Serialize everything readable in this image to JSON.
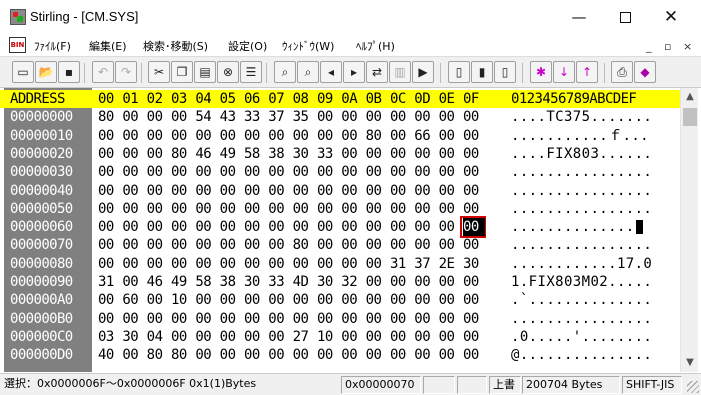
{
  "window": {
    "title": "Stirling - [CM.SYS]",
    "minimize_glyph": "—",
    "close_glyph": "✕"
  },
  "menu": {
    "logo_text": "BIN",
    "items": [
      {
        "label": "ﾌｧｲﾙ(F)"
      },
      {
        "label": "編集(E)"
      },
      {
        "label": "検索･移動(S)"
      },
      {
        "label": "設定(O)"
      },
      {
        "label": "ｳｨﾝﾄﾞｳ(W)"
      },
      {
        "label": "ﾍﾙﾌﾟ(H)"
      }
    ],
    "mdi_min": "_",
    "mdi_restore": "▫",
    "mdi_close": "×"
  },
  "toolbar": {
    "buttons": [
      {
        "name": "new-file",
        "glyph": "▭"
      },
      {
        "name": "open-file",
        "glyph": "📂"
      },
      {
        "name": "save-file",
        "glyph": "▪"
      },
      {
        "name": "undo",
        "glyph": "↶"
      },
      {
        "name": "redo",
        "glyph": "↷"
      },
      {
        "name": "cut",
        "glyph": "✂"
      },
      {
        "name": "copy",
        "glyph": "❐"
      },
      {
        "name": "paste",
        "glyph": "▤"
      },
      {
        "name": "delete",
        "glyph": "⊗"
      },
      {
        "name": "select-all",
        "glyph": "☰"
      },
      {
        "name": "find",
        "glyph": "⌕"
      },
      {
        "name": "find-data",
        "glyph": "⌕"
      },
      {
        "name": "find-prev",
        "glyph": "◂"
      },
      {
        "name": "find-next",
        "glyph": "▸"
      },
      {
        "name": "replace",
        "glyph": "⇄"
      },
      {
        "name": "compare",
        "glyph": "▥"
      },
      {
        "name": "goto",
        "glyph": "▶"
      },
      {
        "name": "insert-mode",
        "glyph": "▯"
      },
      {
        "name": "overwrite-mode",
        "glyph": "▮"
      },
      {
        "name": "append-mode",
        "glyph": "▯"
      },
      {
        "name": "mark",
        "glyph": "✱"
      },
      {
        "name": "mark-next",
        "glyph": "↓"
      },
      {
        "name": "mark-prev",
        "glyph": "↑"
      },
      {
        "name": "print",
        "glyph": "⎙"
      },
      {
        "name": "bookmark",
        "glyph": "◆"
      }
    ]
  },
  "hex": {
    "header": {
      "address_label": "ADDRESS",
      "columns": [
        "00",
        "01",
        "02",
        "03",
        "04",
        "05",
        "06",
        "07",
        "08",
        "09",
        "0A",
        "0B",
        "0C",
        "0D",
        "0E",
        "0F"
      ],
      "ascii_label": "0123456789ABCDEF"
    },
    "rows": [
      {
        "addr": "00000000",
        "bytes": [
          "80",
          "00",
          "00",
          "00",
          "54",
          "43",
          "33",
          "37",
          "35",
          "00",
          "00",
          "00",
          "00",
          "00",
          "00",
          "00"
        ],
        "ascii": "....TC375......."
      },
      {
        "addr": "00000010",
        "bytes": [
          "00",
          "00",
          "00",
          "00",
          "00",
          "00",
          "00",
          "00",
          "00",
          "00",
          "00",
          "80",
          "00",
          "66",
          "00",
          "00"
        ],
        "ascii": "...........ｆ..."
      },
      {
        "addr": "00000020",
        "bytes": [
          "00",
          "00",
          "00",
          "80",
          "46",
          "49",
          "58",
          "38",
          "30",
          "33",
          "00",
          "00",
          "00",
          "00",
          "00",
          "00"
        ],
        "ascii": "....FIX803......"
      },
      {
        "addr": "00000030",
        "bytes": [
          "00",
          "00",
          "00",
          "00",
          "00",
          "00",
          "00",
          "00",
          "00",
          "00",
          "00",
          "00",
          "00",
          "00",
          "00",
          "00"
        ],
        "ascii": "................"
      },
      {
        "addr": "00000040",
        "bytes": [
          "00",
          "00",
          "00",
          "00",
          "00",
          "00",
          "00",
          "00",
          "00",
          "00",
          "00",
          "00",
          "00",
          "00",
          "00",
          "00"
        ],
        "ascii": "................"
      },
      {
        "addr": "00000050",
        "bytes": [
          "00",
          "00",
          "00",
          "00",
          "00",
          "00",
          "00",
          "00",
          "00",
          "00",
          "00",
          "00",
          "00",
          "00",
          "00",
          "00"
        ],
        "ascii": "................"
      },
      {
        "addr": "00000060",
        "bytes": [
          "00",
          "00",
          "00",
          "00",
          "00",
          "00",
          "00",
          "00",
          "00",
          "00",
          "00",
          "00",
          "00",
          "00",
          "00",
          "00"
        ],
        "ascii": "..............."
      },
      {
        "addr": "00000070",
        "bytes": [
          "00",
          "00",
          "00",
          "00",
          "00",
          "00",
          "00",
          "00",
          "80",
          "00",
          "00",
          "00",
          "00",
          "00",
          "00",
          "00"
        ],
        "ascii": "................"
      },
      {
        "addr": "00000080",
        "bytes": [
          "00",
          "00",
          "00",
          "00",
          "00",
          "00",
          "00",
          "00",
          "00",
          "00",
          "00",
          "00",
          "31",
          "37",
          "2E",
          "30"
        ],
        "ascii": "............17.0"
      },
      {
        "addr": "00000090",
        "bytes": [
          "31",
          "00",
          "46",
          "49",
          "58",
          "38",
          "30",
          "33",
          "4D",
          "30",
          "32",
          "00",
          "00",
          "00",
          "00",
          "00"
        ],
        "ascii": "1.FIX803M02....."
      },
      {
        "addr": "000000A0",
        "bytes": [
          "00",
          "60",
          "00",
          "10",
          "00",
          "00",
          "00",
          "00",
          "00",
          "00",
          "00",
          "00",
          "00",
          "00",
          "00",
          "00"
        ],
        "ascii": ".`.............."
      },
      {
        "addr": "000000B0",
        "bytes": [
          "00",
          "00",
          "00",
          "00",
          "00",
          "00",
          "00",
          "00",
          "00",
          "00",
          "00",
          "00",
          "00",
          "00",
          "00",
          "00"
        ],
        "ascii": "................"
      },
      {
        "addr": "000000C0",
        "bytes": [
          "03",
          "30",
          "04",
          "00",
          "00",
          "00",
          "00",
          "00",
          "27",
          "10",
          "00",
          "00",
          "00",
          "00",
          "00",
          "00"
        ],
        "ascii": ".0.....'........"
      },
      {
        "addr": "000000D0",
        "bytes": [
          "40",
          "00",
          "80",
          "80",
          "00",
          "00",
          "00",
          "00",
          "00",
          "00",
          "00",
          "00",
          "00",
          "00",
          "00",
          "00"
        ],
        "ascii": "@..............."
      }
    ],
    "selected": {
      "row": 6,
      "col": 15
    }
  },
  "scrollbar": {
    "up": "▲",
    "down": "▼"
  },
  "status": {
    "selection": "選択：0x0000006F～0x0000006F  0x1(1)Bytes",
    "offset": "0x00000070",
    "blank1": "",
    "blank2": "",
    "mode": "上書",
    "size": "200704 Bytes",
    "encoding": "SHIFT-JIS"
  }
}
